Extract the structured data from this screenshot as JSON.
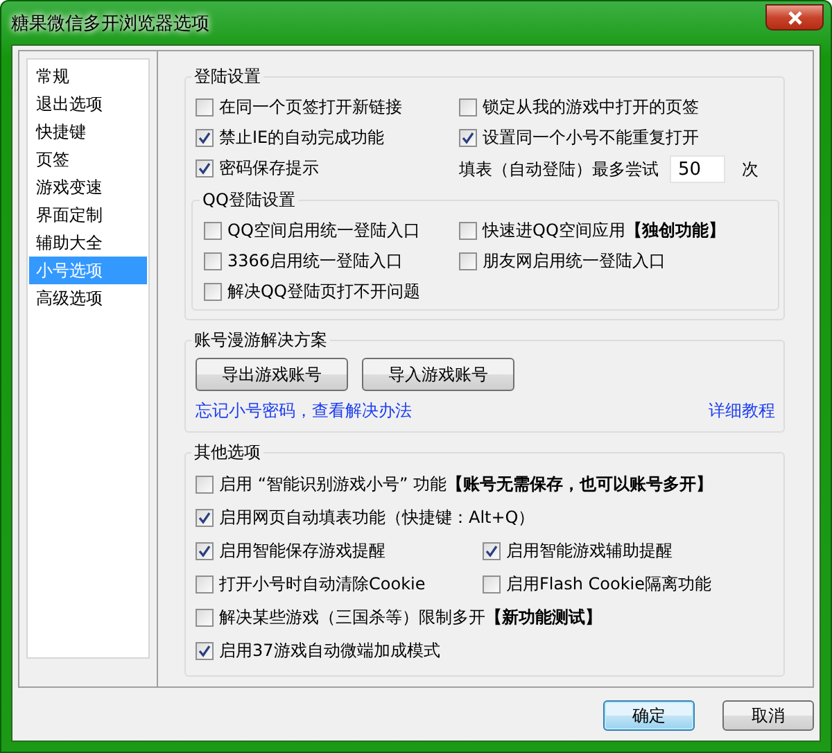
{
  "window": {
    "title": "糖果微信多开浏览器选项"
  },
  "sidebar": {
    "items": [
      {
        "label": "常规",
        "selected": false
      },
      {
        "label": "退出选项",
        "selected": false
      },
      {
        "label": "快捷键",
        "selected": false
      },
      {
        "label": "页签",
        "selected": false
      },
      {
        "label": "游戏变速",
        "selected": false
      },
      {
        "label": "界面定制",
        "selected": false
      },
      {
        "label": "辅助大全",
        "selected": false
      },
      {
        "label": "小号选项",
        "selected": true
      },
      {
        "label": "高级选项",
        "selected": false
      }
    ]
  },
  "login_settings": {
    "title": "登陆设置",
    "options": [
      {
        "label": "在同一个页签打开新链接",
        "checked": false
      },
      {
        "label": "锁定从我的游戏中打开的页签",
        "checked": false
      },
      {
        "label": "禁止IE的自动完成功能",
        "checked": true
      },
      {
        "label": "设置同一个小号不能重复打开",
        "checked": true
      },
      {
        "label": "密码保存提示",
        "checked": true
      }
    ],
    "retry": {
      "label": "填表（自动登陆）最多尝试",
      "value": "50",
      "unit": "次"
    },
    "qq_login": {
      "title": "QQ登陆设置",
      "options": [
        {
          "label": "QQ空间启用统一登陆入口",
          "checked": false
        },
        {
          "label": "快速进QQ空间应用**【独创功能】**",
          "checked": false
        },
        {
          "label": "3366启用统一登陆入口",
          "checked": false
        },
        {
          "label": "朋友网启用统一登陆入口",
          "checked": false
        },
        {
          "label": "解决QQ登陆页打不开问题",
          "checked": false
        }
      ]
    }
  },
  "roaming": {
    "title": "账号漫游解决方案",
    "buttons": [
      "导出游戏账号",
      "导入游戏账号"
    ],
    "links": [
      "忘记小号密码，查看解决办法",
      "详细教程"
    ]
  },
  "other": {
    "title": "其他选项",
    "options": [
      {
        "label": "启用 “智能识别游戏小号” 功能**【账号无需保存，也可以账号多开】**",
        "checked": false,
        "kind": "wide"
      },
      {
        "label": "启用网页自动填表功能（快捷键：Alt+Q）",
        "checked": true,
        "kind": "wide"
      },
      {
        "label": "启用智能保存游戏提醒",
        "checked": true,
        "kind": "half"
      },
      {
        "label": "启用智能游戏辅助提醒",
        "checked": true,
        "kind": "half"
      },
      {
        "label": "打开小号时自动清除Cookie",
        "checked": false,
        "kind": "half"
      },
      {
        "label": "启用Flash Cookie隔离功能",
        "checked": false,
        "kind": "half"
      },
      {
        "label": "解决某些游戏（三国杀等）限制多开**【新功能测试】**",
        "checked": false,
        "kind": "wide"
      },
      {
        "label": "启用37游戏自动微端加成模式",
        "checked": true,
        "kind": "wide"
      }
    ]
  },
  "footer": {
    "buttons": [
      {
        "label": "确定",
        "default": true
      },
      {
        "label": "取消",
        "default": false
      }
    ]
  }
}
